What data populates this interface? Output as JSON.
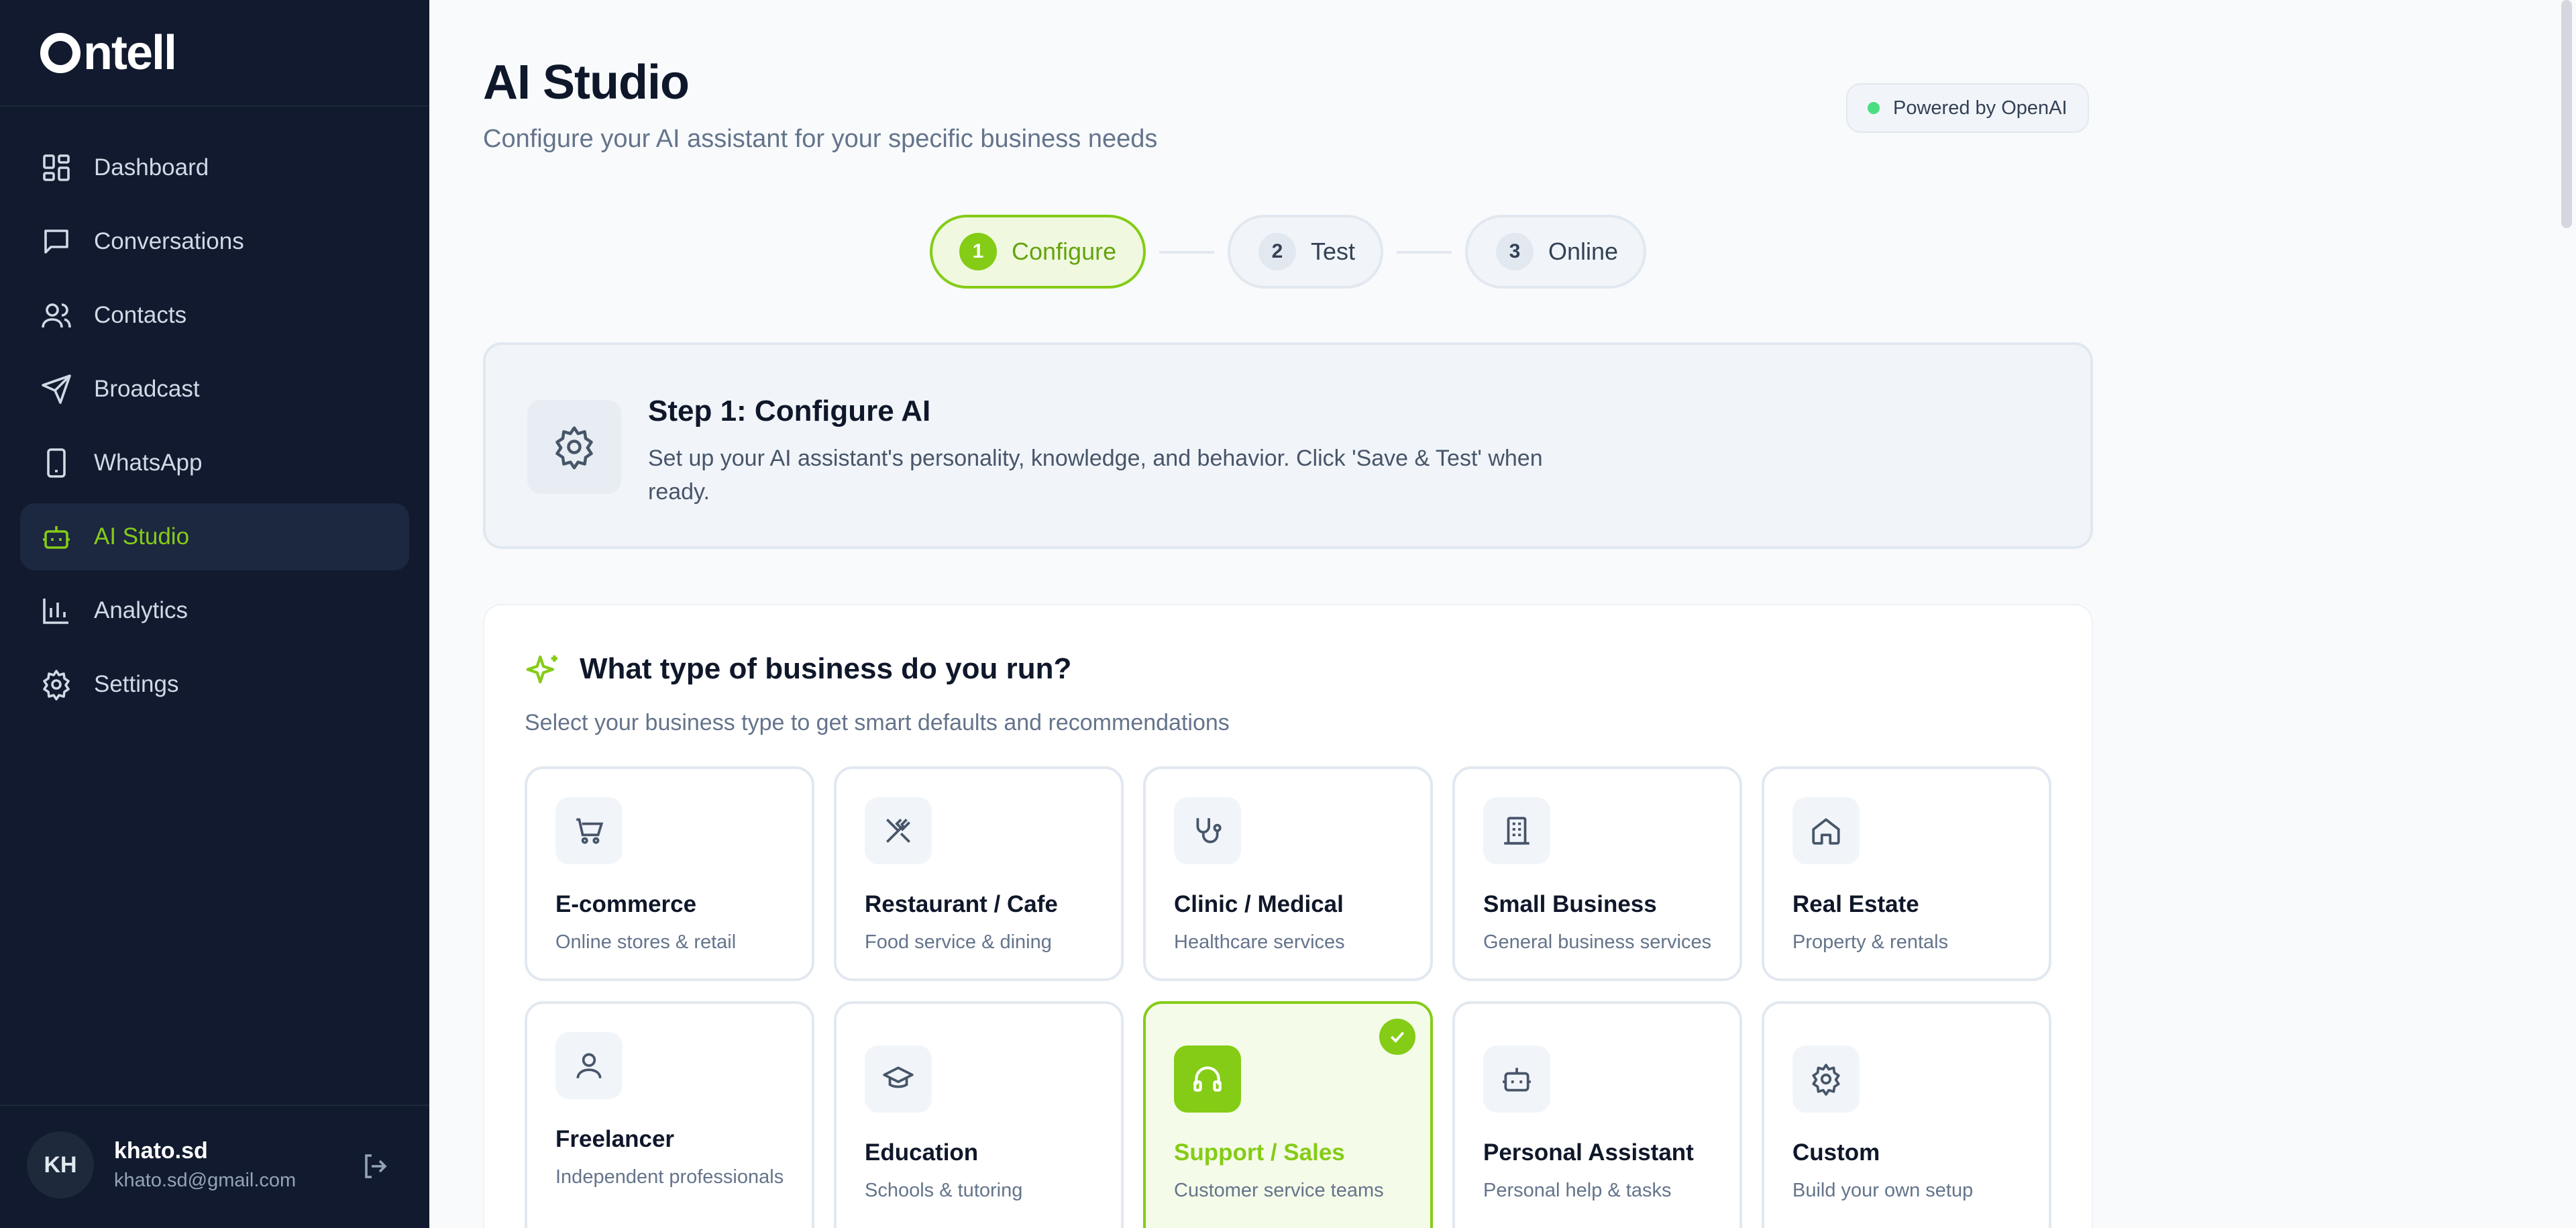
{
  "app": {
    "name": "ntell"
  },
  "sidebar": {
    "items": [
      {
        "label": "Dashboard",
        "icon": "dashboard-icon"
      },
      {
        "label": "Conversations",
        "icon": "chat-icon"
      },
      {
        "label": "Contacts",
        "icon": "users-icon"
      },
      {
        "label": "Broadcast",
        "icon": "send-icon"
      },
      {
        "label": "WhatsApp",
        "icon": "phone-icon"
      },
      {
        "label": "AI Studio",
        "icon": "bot-icon",
        "active": true
      },
      {
        "label": "Analytics",
        "icon": "chart-icon"
      },
      {
        "label": "Settings",
        "icon": "gear-icon"
      }
    ],
    "user": {
      "initials": "KH",
      "name": "khato.sd",
      "email": "khato.sd@gmail.com"
    }
  },
  "header": {
    "title": "AI Studio",
    "subtitle": "Configure your AI assistant for your specific business needs",
    "powered": "Powered by OpenAI"
  },
  "stepper": [
    {
      "num": "1",
      "label": "Configure",
      "active": true
    },
    {
      "num": "2",
      "label": "Test"
    },
    {
      "num": "3",
      "label": "Online"
    }
  ],
  "banner": {
    "title": "Step 1: Configure AI",
    "desc": "Set up your AI assistant's personality, knowledge, and behavior. Click 'Save & Test' when ready."
  },
  "business": {
    "title": "What type of business do you run?",
    "subtitle": "Select your business type to get smart defaults and recommendations",
    "types": [
      {
        "title": "E-commerce",
        "desc": "Online stores & retail"
      },
      {
        "title": "Restaurant / Cafe",
        "desc": "Food service & dining"
      },
      {
        "title": "Clinic / Medical",
        "desc": "Healthcare services"
      },
      {
        "title": "Small Business",
        "desc": "General business services"
      },
      {
        "title": "Real Estate",
        "desc": "Property & rentals"
      },
      {
        "title": "Freelancer",
        "desc": "Independent professionals"
      },
      {
        "title": "Education",
        "desc": "Schools & tutoring"
      },
      {
        "title": "Support / Sales",
        "desc": "Customer service teams",
        "selected": true
      },
      {
        "title": "Personal Assistant",
        "desc": "Personal help & tasks"
      },
      {
        "title": "Custom",
        "desc": "Build your own setup"
      }
    ]
  },
  "colors": {
    "accent": "#84cc16",
    "sidebar": "#111a2e"
  }
}
